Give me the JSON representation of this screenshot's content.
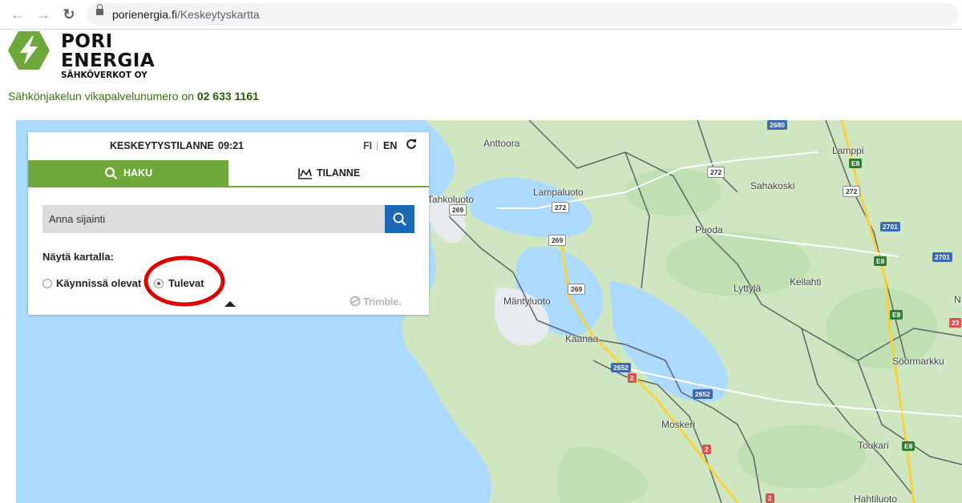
{
  "browser": {
    "url_domain": "porienergia.fi",
    "url_path": "/Keskeytyskartta",
    "back_icon": "←",
    "forward_icon": "→",
    "reload_icon": "↻"
  },
  "header": {
    "brand_line1": "PORI",
    "brand_line2": "ENERGIA",
    "brand_line3": "SÄHKÖVERKOT OY",
    "hotline_text": "Sähkönjakelun vikapalvelunumero on ",
    "hotline_number": "02 633 1161",
    "logo_color": "#6ea83a"
  },
  "panel": {
    "title": "KESKEYTYSTILANNE",
    "time": "09:21",
    "lang_fi": "FI",
    "lang_sep": "|",
    "lang_en": "EN",
    "tabs": [
      {
        "label": "HAKU",
        "icon": "search-icon",
        "active": true
      },
      {
        "label": "TILANNE",
        "icon": "chart-icon",
        "active": false
      }
    ],
    "search_placeholder": "Anna sijainti",
    "show_label": "Näytä kartalla:",
    "radio_options": [
      {
        "label": "Käynnissä olevat",
        "selected": false
      },
      {
        "label": "Tulevat",
        "selected": true
      }
    ],
    "watermark": "Trimble.",
    "accent_color": "#6ea83a",
    "button_color": "#1b69b6"
  },
  "map": {
    "places": [
      "Anttoora",
      "Tahkoluoto",
      "Lampaluoto",
      "Sahakoski",
      "Lamppi",
      "Puoda",
      "Kellahti",
      "Lyttylä",
      "Mäntyluoto",
      "Kaanaa",
      "Söörmarkku",
      "Moskeri",
      "Toukari",
      "Hahtiluoto"
    ],
    "road_labels": [
      "2680",
      "272",
      "272",
      "272",
      "269",
      "269",
      "269",
      "2701",
      "2701",
      "E8",
      "E8",
      "E8",
      "E8",
      "2652",
      "2652",
      "2",
      "2",
      "2",
      "23",
      "N"
    ],
    "highlight_color": "#e00000"
  }
}
